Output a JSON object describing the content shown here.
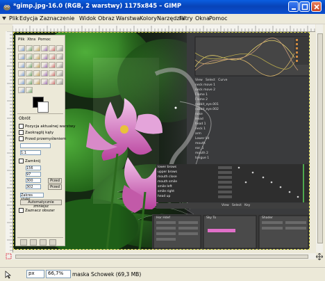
{
  "window": {
    "title": "*gimp.jpg-16.0 (RGB, 2 warstwy) 1175x845 – GIMP",
    "app_icon": "gimp-wilber-icon",
    "controls": [
      "minimize-icon",
      "maximize-icon",
      "close-icon"
    ]
  },
  "menu": {
    "items": [
      "Plik",
      "Edycja",
      "Zaznaczenie",
      "Widok",
      "Obraz",
      "Warstwa",
      "Kolory",
      "Narzędzia",
      "Filtry",
      "Okna",
      "Pomoc"
    ]
  },
  "toolbox": {
    "menu": [
      "Plik",
      "Xtns",
      "Pomoc"
    ],
    "options_title": "Obrót",
    "options": {
      "check1": "Pozycja aktualnej warstwy",
      "check2": "Zaokrąglij kąty",
      "check3": "Przed przemyśleniem",
      "check4": "Zamknij"
    },
    "fields": {
      "x": "156",
      "y": "97",
      "w": "300",
      "h": "302",
      "ratio": "1:1"
    },
    "buttons": {
      "b1": "Przed",
      "b2": "Przed",
      "fixed": "Zakres stałej",
      "auto": "Automatycznie zmniejsz"
    },
    "last_check": "Zaznacz obszar"
  },
  "canvas_overlay": {
    "mixer_header": [
      "View",
      "Select",
      "Curve"
    ],
    "channel_rows": [
      "neck move 1",
      "neck move 2",
      "Flame 1",
      "Flame 2",
      "rabbit_eye.001",
      "rabbit_eye.002",
      "nose",
      "Head",
      "head 1",
      "neck 1",
      "arm",
      "Lower lid",
      "mouth",
      "ear_1",
      "mouth 2",
      "tongue 1"
    ],
    "seq_rows": [
      "lower brows",
      "upper brows",
      "mouth close",
      "mouth smile",
      "smile left",
      "smile right",
      "head up"
    ],
    "bottom_panels": [
      "Hor Hdef",
      "Sky To",
      "Shader"
    ],
    "view_bar": [
      "View",
      "Select",
      "Key"
    ]
  },
  "status": {
    "unit": "px",
    "zoom": "66,7%",
    "message": "maska Schowek (69,3 MB)"
  },
  "colors": {
    "titlebar": "#0b4ecf",
    "window_bg": "#ece9d8",
    "selection": "#d8d84a"
  }
}
